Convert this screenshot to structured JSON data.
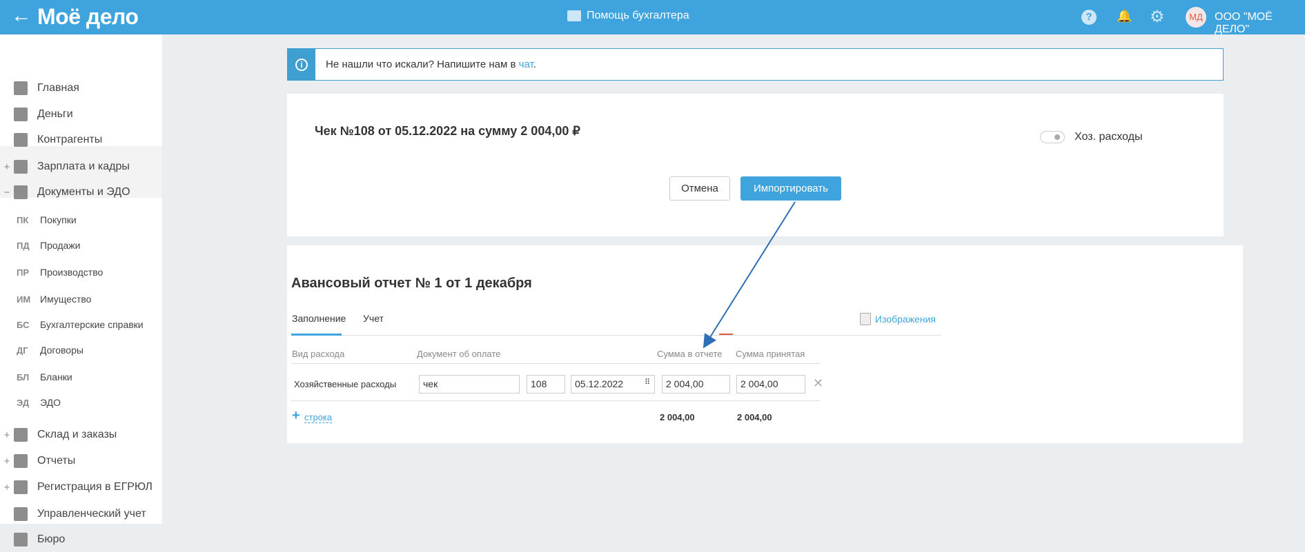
{
  "header": {
    "back": "←",
    "logo": "Моё дело",
    "help": "Помощь бухгалтера",
    "org": "ООО \"МОЁ ДЕЛО\"",
    "avatar": "МД",
    "help_icon": "?",
    "bell_icon": "🔔",
    "gear_icon": "⚙"
  },
  "sidebar": {
    "items": [
      {
        "label": "Главная",
        "pm": ""
      },
      {
        "label": "Деньги",
        "pm": ""
      },
      {
        "label": "Контрагенты",
        "pm": ""
      },
      {
        "label": "Зарплата и кадры",
        "pm": "+"
      },
      {
        "label": "Документы и ЭДО",
        "pm": "−"
      }
    ],
    "sub": [
      {
        "ab": "ПК",
        "label": "Покупки"
      },
      {
        "ab": "ПД",
        "label": "Продажи"
      },
      {
        "ab": "ПР",
        "label": "Производство"
      },
      {
        "ab": "ИМ",
        "label": "Имущество"
      },
      {
        "ab": "БС",
        "label": "Бухгалтерские справки"
      },
      {
        "ab": "ДГ",
        "label": "Договоры"
      },
      {
        "ab": "БЛ",
        "label": "Бланки"
      },
      {
        "ab": "ЭД",
        "label": "ЭДО"
      }
    ],
    "items2": [
      {
        "label": "Склад и заказы",
        "pm": "+"
      },
      {
        "label": "Отчеты",
        "pm": "+"
      },
      {
        "label": "Регистрация в ЕГРЮЛ",
        "pm": "+"
      },
      {
        "label": "Управленческий учет",
        "pm": ""
      },
      {
        "label": "Бюро",
        "pm": ""
      }
    ]
  },
  "info": {
    "text": "Не нашли что искали? Напишите нам в ",
    "link": "чат",
    "end": "."
  },
  "receipt": {
    "title": "Чек №108 от 05.12.2022 на сумму 2 004,00 ₽",
    "toggle_label": "Хоз. расходы",
    "cancel": "Отмена",
    "import": "Импортировать"
  },
  "report": {
    "title": "Авансовый отчет № 1 от 1 декабря",
    "tabs": [
      "Заполнение",
      "Учет"
    ],
    "images": "Изображения",
    "columns": [
      "Вид расхода",
      "Документ об оплате",
      "Сумма в отчете",
      "Сумма принятая"
    ],
    "row": {
      "type": "Хозяйственные расходы",
      "doc": "чек",
      "num": "108",
      "date": "05.12.2022",
      "sum": "2 004,00",
      "accepted": "2 004,00"
    },
    "add": "строка",
    "total_sum": "2 004,00",
    "total_accepted": "2 004,00"
  }
}
